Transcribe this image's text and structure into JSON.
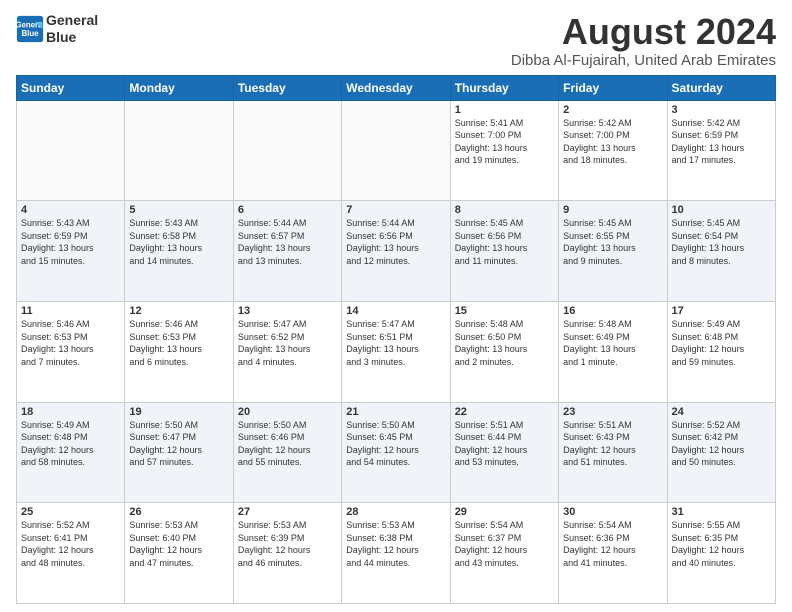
{
  "logo": {
    "line1": "General",
    "line2": "Blue"
  },
  "title": "August 2024",
  "location": "Dibba Al-Fujairah, United Arab Emirates",
  "days_of_week": [
    "Sunday",
    "Monday",
    "Tuesday",
    "Wednesday",
    "Thursday",
    "Friday",
    "Saturday"
  ],
  "weeks": [
    [
      {
        "day": "",
        "info": ""
      },
      {
        "day": "",
        "info": ""
      },
      {
        "day": "",
        "info": ""
      },
      {
        "day": "",
        "info": ""
      },
      {
        "day": "1",
        "info": "Sunrise: 5:41 AM\nSunset: 7:00 PM\nDaylight: 13 hours\nand 19 minutes."
      },
      {
        "day": "2",
        "info": "Sunrise: 5:42 AM\nSunset: 7:00 PM\nDaylight: 13 hours\nand 18 minutes."
      },
      {
        "day": "3",
        "info": "Sunrise: 5:42 AM\nSunset: 6:59 PM\nDaylight: 13 hours\nand 17 minutes."
      }
    ],
    [
      {
        "day": "4",
        "info": "Sunrise: 5:43 AM\nSunset: 6:59 PM\nDaylight: 13 hours\nand 15 minutes."
      },
      {
        "day": "5",
        "info": "Sunrise: 5:43 AM\nSunset: 6:58 PM\nDaylight: 13 hours\nand 14 minutes."
      },
      {
        "day": "6",
        "info": "Sunrise: 5:44 AM\nSunset: 6:57 PM\nDaylight: 13 hours\nand 13 minutes."
      },
      {
        "day": "7",
        "info": "Sunrise: 5:44 AM\nSunset: 6:56 PM\nDaylight: 13 hours\nand 12 minutes."
      },
      {
        "day": "8",
        "info": "Sunrise: 5:45 AM\nSunset: 6:56 PM\nDaylight: 13 hours\nand 11 minutes."
      },
      {
        "day": "9",
        "info": "Sunrise: 5:45 AM\nSunset: 6:55 PM\nDaylight: 13 hours\nand 9 minutes."
      },
      {
        "day": "10",
        "info": "Sunrise: 5:45 AM\nSunset: 6:54 PM\nDaylight: 13 hours\nand 8 minutes."
      }
    ],
    [
      {
        "day": "11",
        "info": "Sunrise: 5:46 AM\nSunset: 6:53 PM\nDaylight: 13 hours\nand 7 minutes."
      },
      {
        "day": "12",
        "info": "Sunrise: 5:46 AM\nSunset: 6:53 PM\nDaylight: 13 hours\nand 6 minutes."
      },
      {
        "day": "13",
        "info": "Sunrise: 5:47 AM\nSunset: 6:52 PM\nDaylight: 13 hours\nand 4 minutes."
      },
      {
        "day": "14",
        "info": "Sunrise: 5:47 AM\nSunset: 6:51 PM\nDaylight: 13 hours\nand 3 minutes."
      },
      {
        "day": "15",
        "info": "Sunrise: 5:48 AM\nSunset: 6:50 PM\nDaylight: 13 hours\nand 2 minutes."
      },
      {
        "day": "16",
        "info": "Sunrise: 5:48 AM\nSunset: 6:49 PM\nDaylight: 13 hours\nand 1 minute."
      },
      {
        "day": "17",
        "info": "Sunrise: 5:49 AM\nSunset: 6:48 PM\nDaylight: 12 hours\nand 59 minutes."
      }
    ],
    [
      {
        "day": "18",
        "info": "Sunrise: 5:49 AM\nSunset: 6:48 PM\nDaylight: 12 hours\nand 58 minutes."
      },
      {
        "day": "19",
        "info": "Sunrise: 5:50 AM\nSunset: 6:47 PM\nDaylight: 12 hours\nand 57 minutes."
      },
      {
        "day": "20",
        "info": "Sunrise: 5:50 AM\nSunset: 6:46 PM\nDaylight: 12 hours\nand 55 minutes."
      },
      {
        "day": "21",
        "info": "Sunrise: 5:50 AM\nSunset: 6:45 PM\nDaylight: 12 hours\nand 54 minutes."
      },
      {
        "day": "22",
        "info": "Sunrise: 5:51 AM\nSunset: 6:44 PM\nDaylight: 12 hours\nand 53 minutes."
      },
      {
        "day": "23",
        "info": "Sunrise: 5:51 AM\nSunset: 6:43 PM\nDaylight: 12 hours\nand 51 minutes."
      },
      {
        "day": "24",
        "info": "Sunrise: 5:52 AM\nSunset: 6:42 PM\nDaylight: 12 hours\nand 50 minutes."
      }
    ],
    [
      {
        "day": "25",
        "info": "Sunrise: 5:52 AM\nSunset: 6:41 PM\nDaylight: 12 hours\nand 48 minutes."
      },
      {
        "day": "26",
        "info": "Sunrise: 5:53 AM\nSunset: 6:40 PM\nDaylight: 12 hours\nand 47 minutes."
      },
      {
        "day": "27",
        "info": "Sunrise: 5:53 AM\nSunset: 6:39 PM\nDaylight: 12 hours\nand 46 minutes."
      },
      {
        "day": "28",
        "info": "Sunrise: 5:53 AM\nSunset: 6:38 PM\nDaylight: 12 hours\nand 44 minutes."
      },
      {
        "day": "29",
        "info": "Sunrise: 5:54 AM\nSunset: 6:37 PM\nDaylight: 12 hours\nand 43 minutes."
      },
      {
        "day": "30",
        "info": "Sunrise: 5:54 AM\nSunset: 6:36 PM\nDaylight: 12 hours\nand 41 minutes."
      },
      {
        "day": "31",
        "info": "Sunrise: 5:55 AM\nSunset: 6:35 PM\nDaylight: 12 hours\nand 40 minutes."
      }
    ]
  ]
}
